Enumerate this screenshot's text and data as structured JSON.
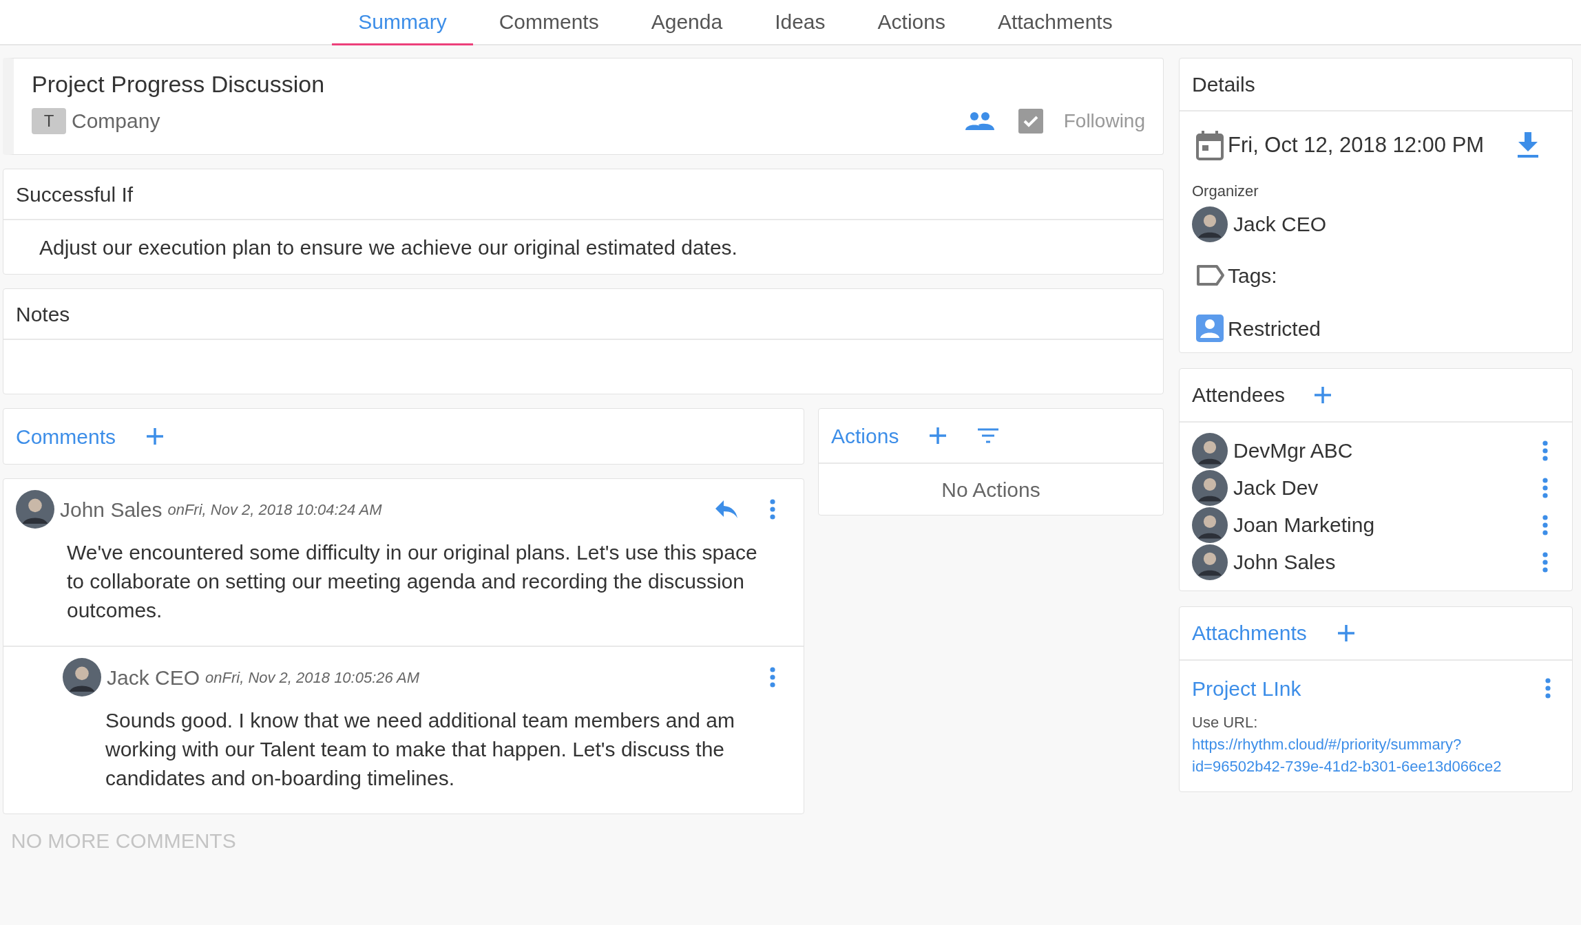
{
  "tabs": [
    {
      "label": "Summary",
      "selected": true
    },
    {
      "label": "Comments",
      "selected": false
    },
    {
      "label": "Agenda",
      "selected": false
    },
    {
      "label": "Ideas",
      "selected": false
    },
    {
      "label": "Actions",
      "selected": false
    },
    {
      "label": "Attachments",
      "selected": false
    }
  ],
  "header": {
    "title": "Project Progress Discussion",
    "tag_letter": "T",
    "tag": "Company",
    "following": {
      "label": "Following",
      "checked": true
    }
  },
  "successful_if": {
    "title": "Successful If",
    "text": "Adjust our execution plan to ensure we achieve our original estimated dates."
  },
  "notes": {
    "title": "Notes"
  },
  "comments": {
    "title": "Comments",
    "items": [
      {
        "author": "John Sales",
        "meta": "onFri, Nov 2, 2018 10:04:24 AM",
        "text": "We've encountered some difficulty in our original plans. Let's use this space to collaborate on setting our meeting agenda and recording the discussion outcomes.",
        "children": [
          {
            "author": "Jack CEO",
            "meta": "onFri, Nov 2, 2018 10:05:26 AM",
            "text": "Sounds good. I know that we need additional team members and am working with our Talent team to make that happen. Let's discuss the candidates and on-boarding timelines."
          }
        ]
      }
    ],
    "footer": "NO MORE COMMENTS"
  },
  "actions": {
    "title": "Actions",
    "empty": "No Actions"
  },
  "details": {
    "title": "Details",
    "date": "Fri, Oct 12, 2018 12:00 PM",
    "organizer_label": "Organizer",
    "organizer": "Jack CEO",
    "tags_label": "Tags:",
    "access": "Restricted"
  },
  "attendees": {
    "title": "Attendees",
    "people": [
      "DevMgr ABC",
      "Jack Dev",
      "Joan Marketing",
      "John Sales"
    ]
  },
  "attachments": {
    "title": "Attachments",
    "items": [
      {
        "name": "Project LInk",
        "label": "Use URL:",
        "url": "https://rhythm.cloud/#/priority/summary?id=96502b42-739e-41d2-b301-6ee13d066ce2"
      }
    ]
  }
}
